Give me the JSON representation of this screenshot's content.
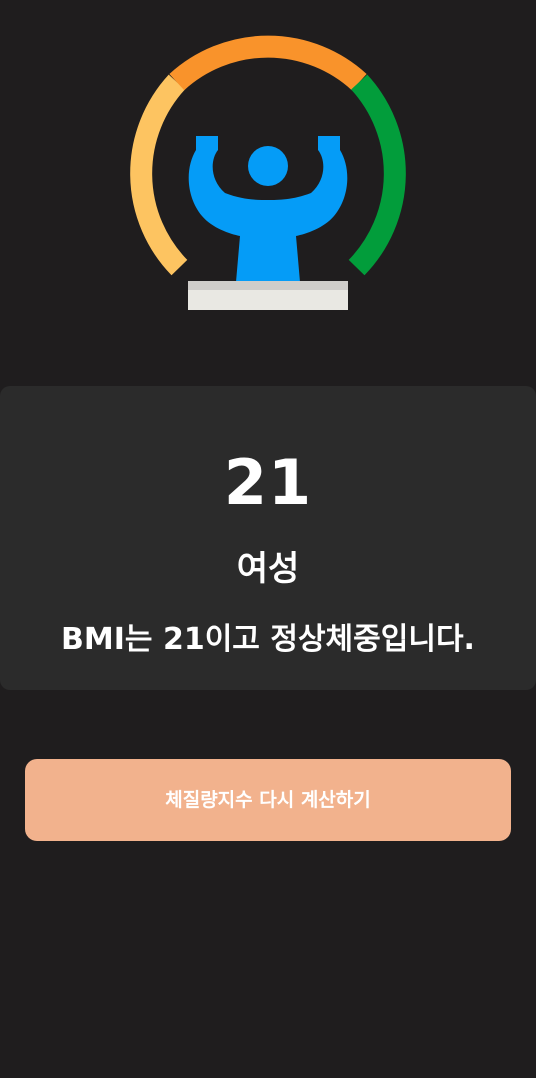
{
  "hero": {
    "icon": "bmi-gauge-weightlifter-icon",
    "colors": {
      "gauge_left": "#fdc461",
      "gauge_top": "#f9932b",
      "gauge_right": "#029d3b",
      "figure": "#059cf7",
      "scale_top": "#cfcdca",
      "scale_body": "#e9e8e3"
    }
  },
  "result": {
    "bmi": "21",
    "gender": "여성",
    "message": "BMI는 21이고 정상체중입니다."
  },
  "actions": {
    "recalculate_label": "체질량지수 다시 계산하기"
  },
  "theme": {
    "background": "#1f1d1e",
    "card": "#2b2b2b",
    "button": "#f2b28d",
    "text": "#ffffff"
  }
}
